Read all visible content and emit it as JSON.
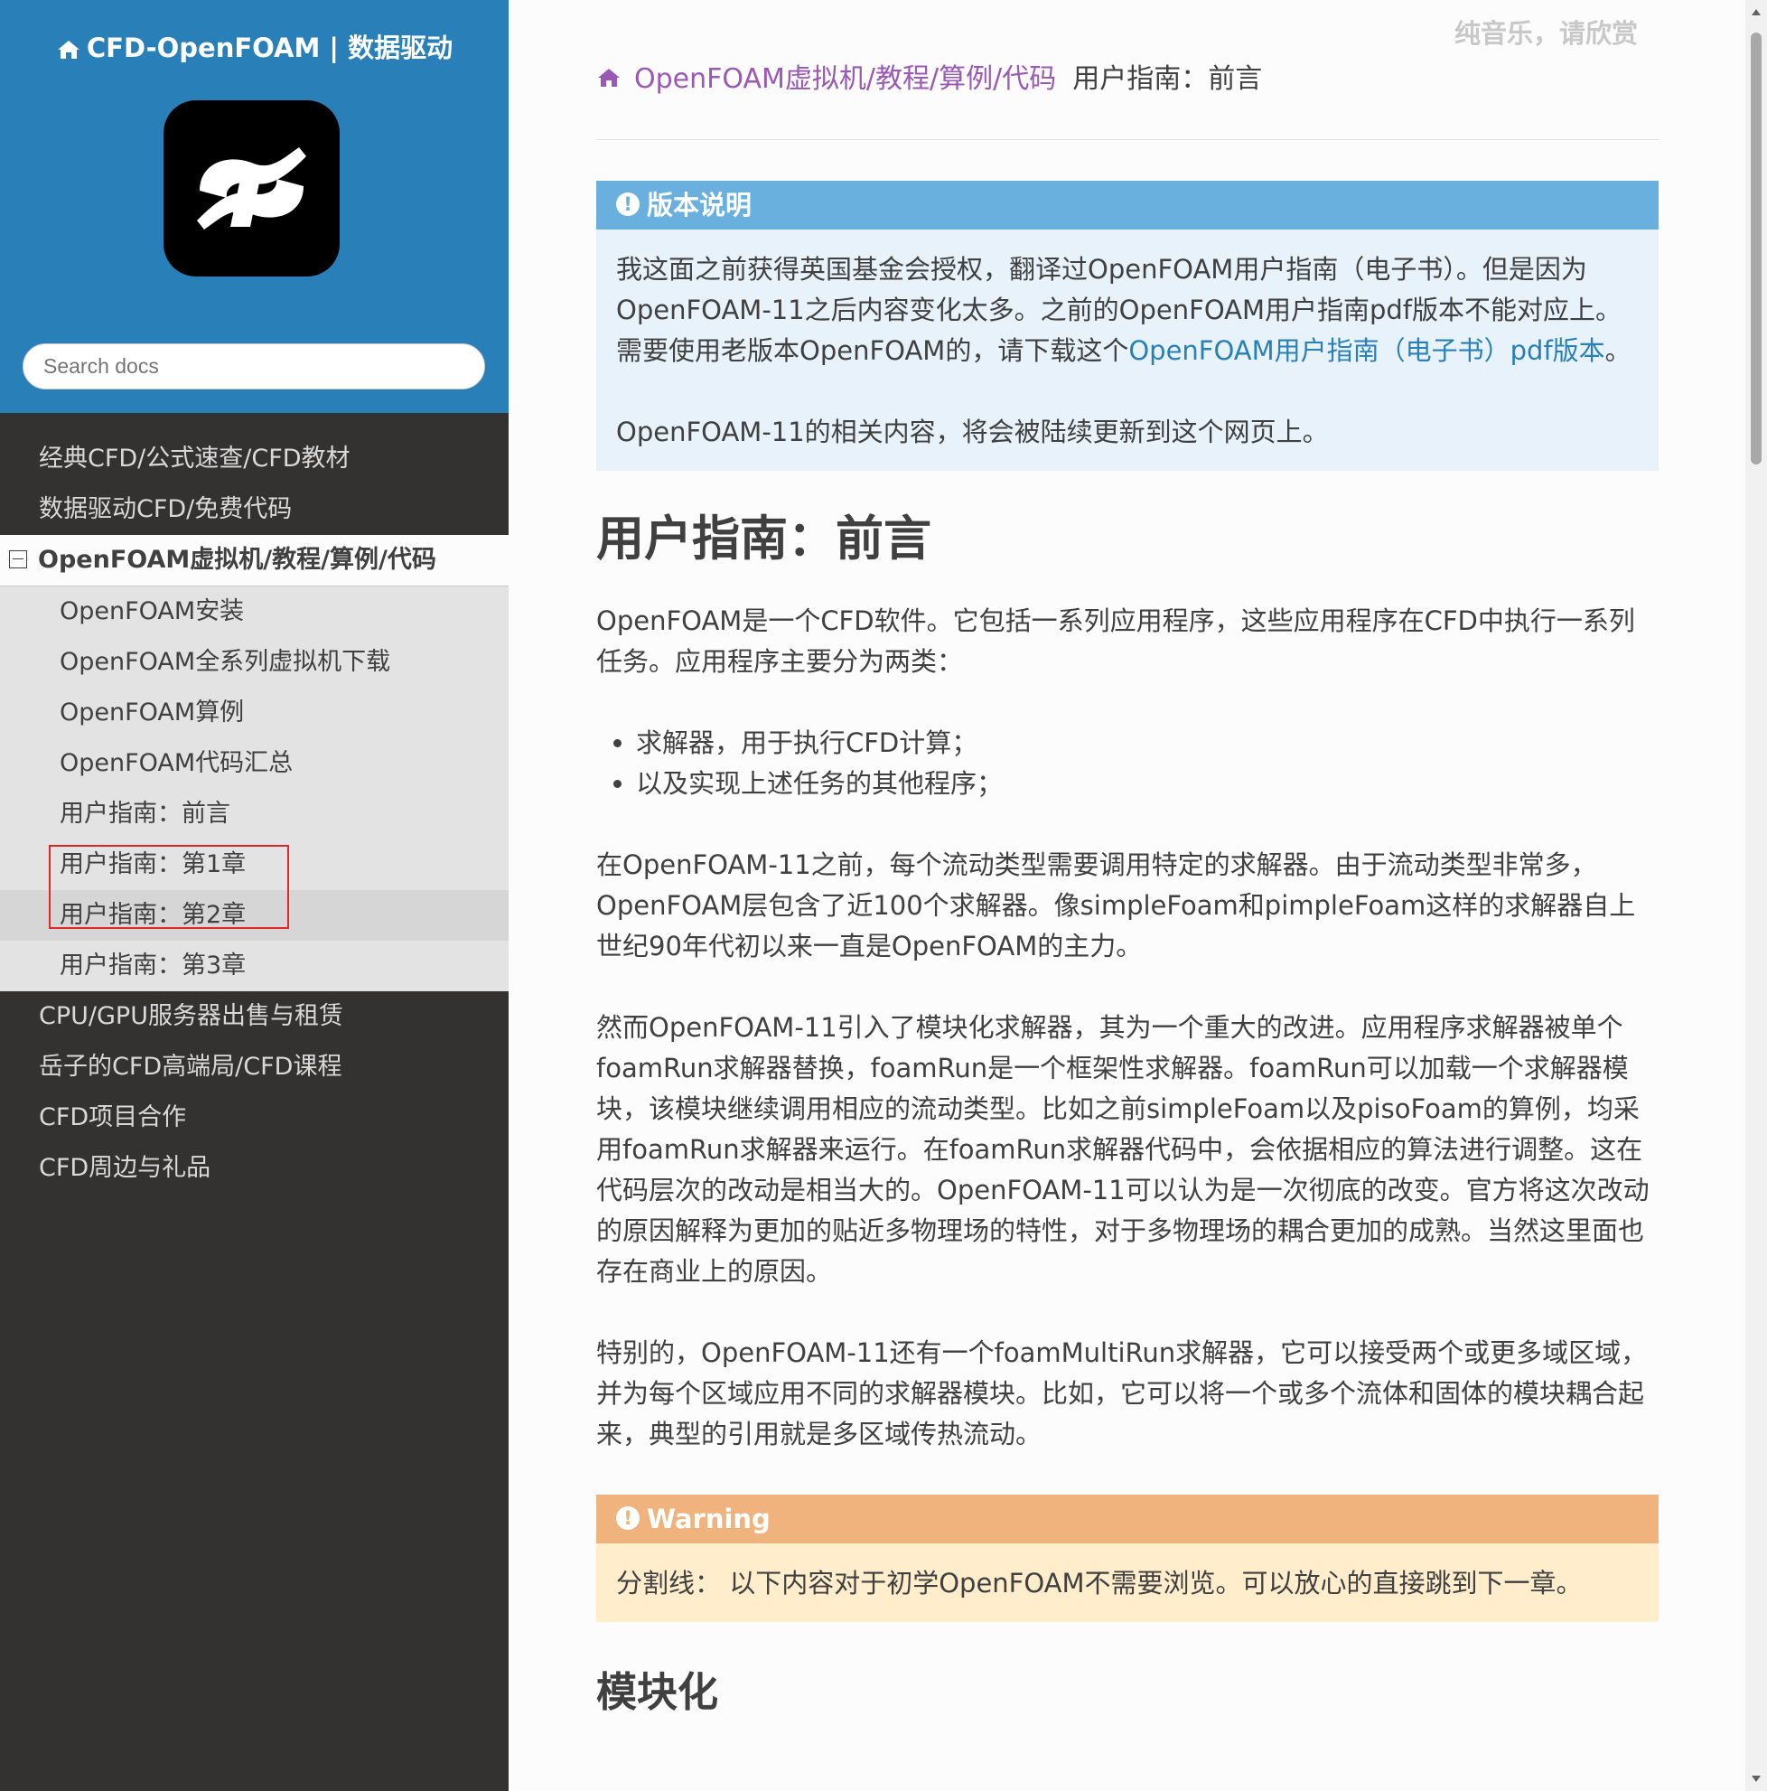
{
  "sidebar": {
    "brand": "CFD-OpenFOAM | 数据驱动",
    "search_placeholder": "Search docs",
    "items_top": [
      "经典CFD/公式速查/CFD教材",
      "数据驱动CFD/免费代码"
    ],
    "current": "OpenFOAM虚拟机/教程/算例/代码",
    "sub_items": [
      "OpenFOAM安装",
      "OpenFOAM全系列虚拟机下载",
      "OpenFOAM算例",
      "OpenFOAM代码汇总",
      "用户指南：前言",
      "用户指南：第1章",
      "用户指南：第2章",
      "用户指南：第3章"
    ],
    "items_bottom": [
      "CPU/GPU服务器出售与租赁",
      "岳子的CFD高端局/CFD课程",
      "CFD项目合作",
      "CFD周边与礼品"
    ]
  },
  "watermark": "纯音乐，请欣赏",
  "breadcrumb": {
    "link": "OpenFOAM虚拟机/教程/算例/代码",
    "current": "用户指南：前言"
  },
  "note": {
    "title": "版本说明",
    "p1_before": "我这面之前获得英国基金会授权，翻译过OpenFOAM用户指南（电子书）。但是因为OpenFOAM-11之后内容变化太多。之前的OpenFOAM用户指南pdf版本不能对应上。需要使用老版本OpenFOAM的，请下载这个",
    "p1_link": "OpenFOAM用户指南（电子书）pdf版本",
    "p1_after": "。",
    "p2": "OpenFOAM-11的相关内容，将会被陆续更新到这个网页上。"
  },
  "main": {
    "title": "用户指南：前言",
    "intro": "OpenFOAM是一个CFD软件。它包括一系列应用程序，这些应用程序在CFD中执行一系列任务。应用程序主要分为两类：",
    "bullets": [
      "求解器，用于执行CFD计算；",
      "以及实现上述任务的其他程序；"
    ],
    "para2": "在OpenFOAM-11之前，每个流动类型需要调用特定的求解器。由于流动类型非常多，OpenFOAM层包含了近100个求解器。像simpleFoam和pimpleFoam这样的求解器自上世纪90年代初以来一直是OpenFOAM的主力。",
    "para3": "然而OpenFOAM-11引入了模块化求解器，其为一个重大的改进。应用程序求解器被单个foamRun求解器替换，foamRun是一个框架性求解器。foamRun可以加载一个求解器模块，该模块继续调用相应的流动类型。比如之前simpleFoam以及pisoFoam的算例，均采用foamRun求解器来运行。在foamRun求解器代码中，会依据相应的算法进行调整。这在代码层次的改动是相当大的。OpenFOAM-11可以认为是一次彻底的改变。官方将这次改动的原因解释为更加的贴近多物理场的特性，对于多物理场的耦合更加的成熟。当然这里面也存在商业上的原因。",
    "para4": "特别的，OpenFOAM-11还有一个foamMultiRun求解器，它可以接受两个或更多域区域，并为每个区域应用不同的求解器模块。比如，它可以将一个或多个流体和固体的模块耦合起来，典型的引用就是多区域传热流动。",
    "warning_title": "Warning",
    "warning_text": "分割线： 以下内容对于初学OpenFOAM不需要浏览。可以放心的直接跳到下一章。",
    "h2": "模块化"
  }
}
